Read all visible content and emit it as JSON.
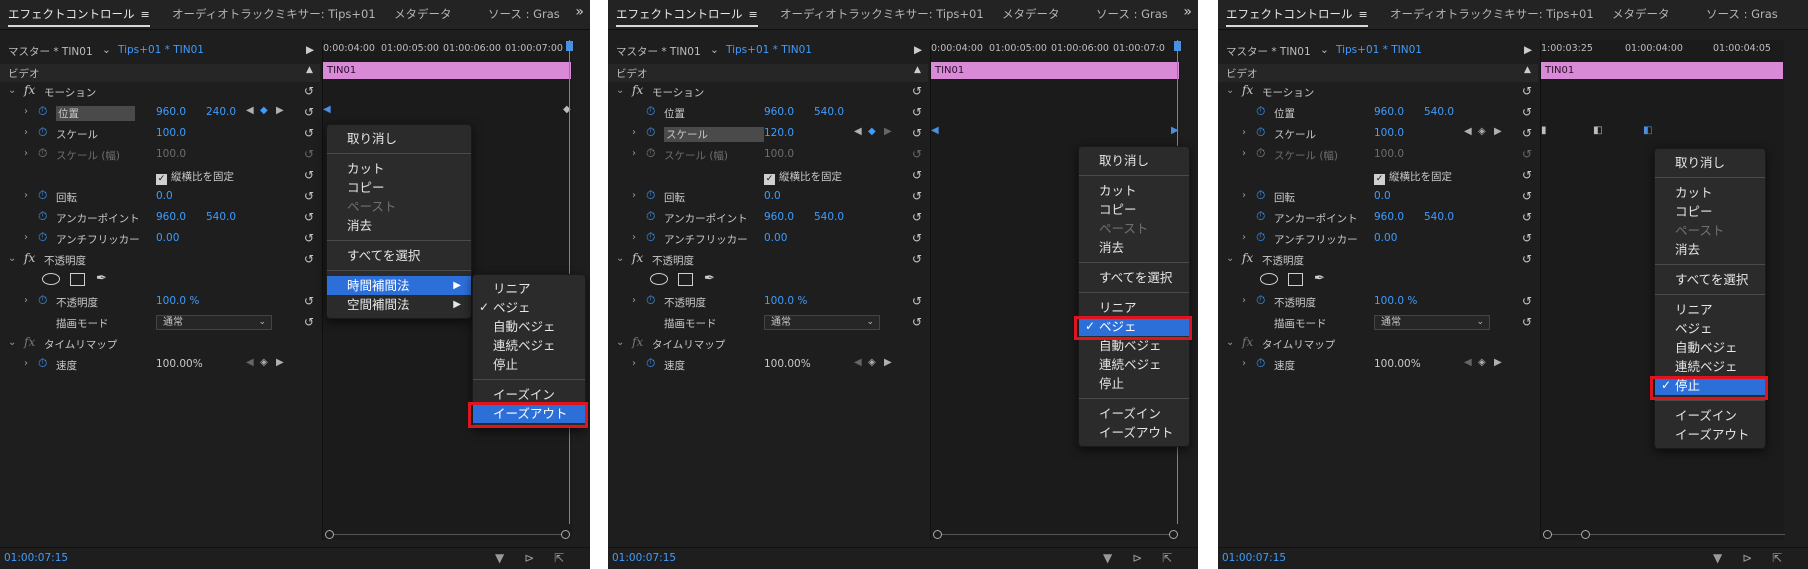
{
  "tabs": {
    "effect_controls": "エフェクトコントロール",
    "menu_glyph": "≡",
    "audio_mixer": "オーディオトラックミキサー: Tips+01",
    "metadata": "メタデータ",
    "source": "ソース : Gras",
    "more": "»"
  },
  "clip_header": {
    "master": "マスター * TIN01",
    "sequence": "Tips+01 * TIN01"
  },
  "section_video": "ビデオ",
  "clip_name": "TIN01",
  "fx_glyph": "fx",
  "properties": {
    "motion": "モーション",
    "position": "位置",
    "position_x": "960.0",
    "position_y": "240.0",
    "position_y_alt": "540.0",
    "scale": "スケール",
    "scale_value_a": "100.0",
    "scale_value_b": "120.0",
    "scale_width": "スケール (幅)",
    "scale_width_value": "100.0",
    "uniform_scale": "縦横比を固定",
    "rotation": "回転",
    "rotation_value": "0.0",
    "anchor": "アンカーポイント",
    "anchor_x": "960.0",
    "anchor_y": "540.0",
    "flicker": "アンチフリッカー",
    "flicker_value": "0.00",
    "opacity_group": "不透明度",
    "opacity": "不透明度",
    "opacity_value": "100.0 %",
    "blend_mode": "描画モード",
    "blend_value": "通常",
    "time_remap": "タイムリマップ",
    "speed": "速度",
    "speed_value": "100.00%"
  },
  "rulers": {
    "p1": [
      "0:00:04:00",
      "01:00:05:00",
      "01:00:06:00",
      "01:00:07:00"
    ],
    "p2": [
      "0:00:04:00",
      "01:00:05:00",
      "01:00:06:00",
      "01:00:07:0"
    ],
    "p3": [
      "1:00:03:25",
      "01:00:04:00",
      "01:00:04:05"
    ]
  },
  "timecode": "01:00:07:15",
  "status_icons": "▼ ⊳ ⇱",
  "menu": {
    "undo": "取り消し",
    "cut": "カット",
    "copy": "コピー",
    "paste": "ペースト",
    "clear": "消去",
    "select_all": "すべてを選択",
    "temporal": "時間補間法",
    "spatial": "空間補間法",
    "linear": "リニア",
    "bezier": "ベジェ",
    "auto_bezier": "自動ベジェ",
    "continuous_bezier": "連続ベジェ",
    "hold": "停止",
    "ease_in": "イーズイン",
    "ease_out": "イーズアウト",
    "check": "✓",
    "submenu_arrow": "▶"
  },
  "colors": {
    "highlight": "#2d6fd8",
    "value_blue": "#3f9cff",
    "clip_pink": "#d98ad7",
    "callout_red": "#e0141e"
  }
}
